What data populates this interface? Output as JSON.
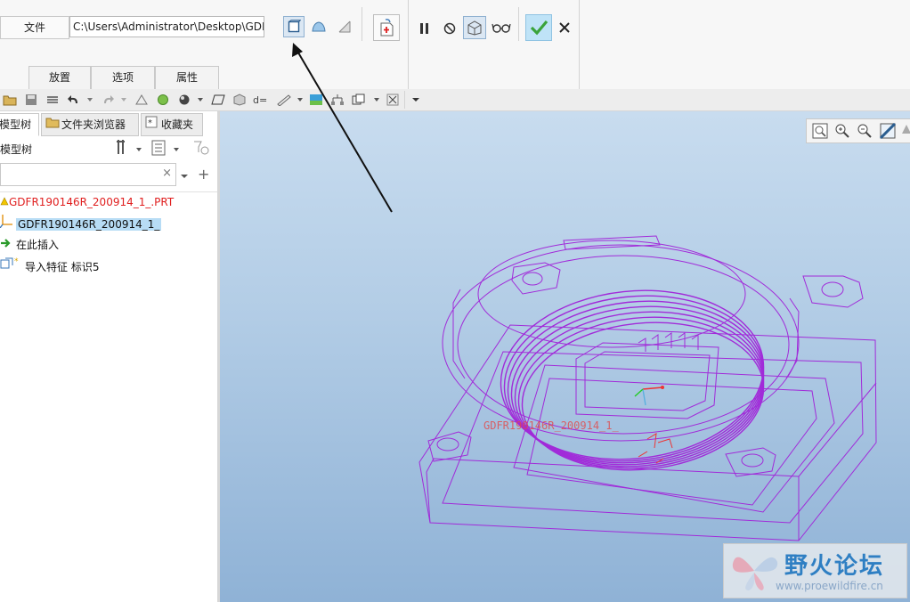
{
  "ribbon": {
    "file_label": "文件",
    "path_value": "C:\\Users\\Administrator\\Desktop\\GDFR",
    "tabs": [
      "放置",
      "选项",
      "属性"
    ]
  },
  "panel": {
    "tabs": [
      "模型树",
      "文件夹浏览器",
      "收藏夹"
    ],
    "header": "模型树",
    "filter_placeholder": "",
    "tree": [
      {
        "label": "GDFR190146R_200914_1_.PRT",
        "color": "#e02020"
      },
      {
        "label": "GDFR190146R_200914_1_",
        "color": "#111111"
      },
      {
        "label": "在此插入",
        "color": "#111111"
      },
      {
        "label": "导入特征 标识5",
        "color": "#111111"
      }
    ]
  },
  "viewport": {
    "model_label": "GDFR190146R_200914_1_",
    "watermark_title": "野火论坛",
    "watermark_url": "www.proewildfire.cn"
  },
  "colors": {
    "wire": "#a12bd9",
    "accept": "#3aa33a",
    "selection": "#b7dcf5"
  }
}
